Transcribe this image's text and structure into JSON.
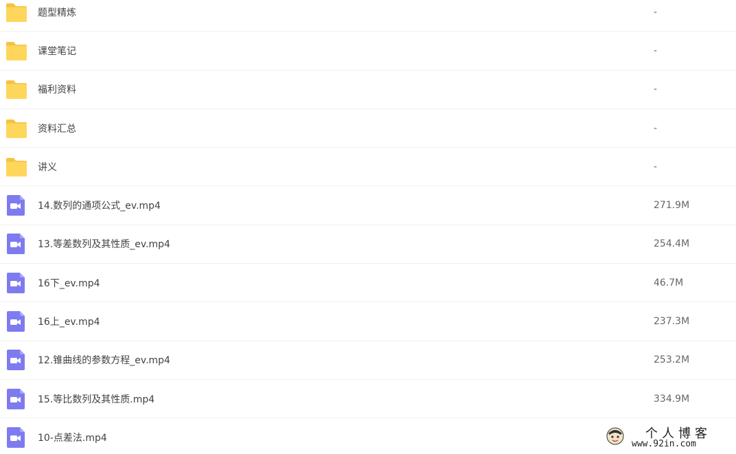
{
  "files": [
    {
      "type": "folder",
      "icon": "folder-icon",
      "name": "题型精炼",
      "size": "-"
    },
    {
      "type": "folder",
      "icon": "folder-icon",
      "name": "课堂笔记",
      "size": "-"
    },
    {
      "type": "folder",
      "icon": "folder-icon",
      "name": "福利资料",
      "size": "-"
    },
    {
      "type": "folder",
      "icon": "folder-icon",
      "name": "资料汇总",
      "size": "-"
    },
    {
      "type": "folder",
      "icon": "folder-icon",
      "name": "讲义",
      "size": "-"
    },
    {
      "type": "video",
      "icon": "video-file-icon",
      "name": "14.数列的通项公式_ev.mp4",
      "size": "271.9M"
    },
    {
      "type": "video",
      "icon": "video-file-icon",
      "name": "13.等差数列及其性质_ev.mp4",
      "size": "254.4M"
    },
    {
      "type": "video",
      "icon": "video-file-icon",
      "name": "16下_ev.mp4",
      "size": "46.7M"
    },
    {
      "type": "video",
      "icon": "video-file-icon",
      "name": "16上_ev.mp4",
      "size": "237.3M"
    },
    {
      "type": "video",
      "icon": "video-file-icon",
      "name": "12.锥曲线的参数方程_ev.mp4",
      "size": "253.2M"
    },
    {
      "type": "video",
      "icon": "video-file-icon",
      "name": "15.等比数列及其性质.mp4",
      "size": "334.9M"
    },
    {
      "type": "video",
      "icon": "video-file-icon",
      "name": "10-点差法.mp4",
      "size": ""
    }
  ],
  "watermark": {
    "title": "个人博客",
    "url": "www.92in.com"
  },
  "colors": {
    "folder": "#FFD65C",
    "folder_tab": "#F5C242",
    "video": "#7E7BF0",
    "divider": "#F0F0F0"
  }
}
